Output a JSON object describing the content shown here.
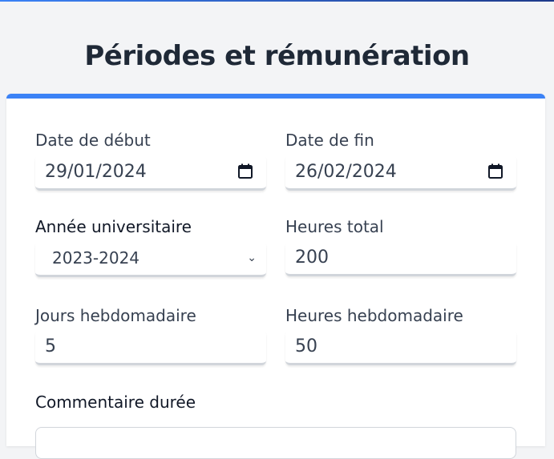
{
  "page": {
    "title": "Périodes et rémunération"
  },
  "form": {
    "start_date": {
      "label": "Date de début",
      "value": "29/01/2024"
    },
    "end_date": {
      "label": "Date de fin",
      "value": "26/02/2024"
    },
    "academic_year": {
      "label": "Année universitaire",
      "value": "2023-2024"
    },
    "total_hours": {
      "label": "Heures total",
      "value": "200"
    },
    "weekly_days": {
      "label": "Jours hebdomadaire",
      "value": "5"
    },
    "weekly_hours": {
      "label": "Heures hebdomadaire",
      "value": "50"
    },
    "duration_comment": {
      "label": "Commentaire durée",
      "value": ""
    }
  },
  "colors": {
    "accent": "#3b82f6",
    "background": "#f3f4f6"
  }
}
